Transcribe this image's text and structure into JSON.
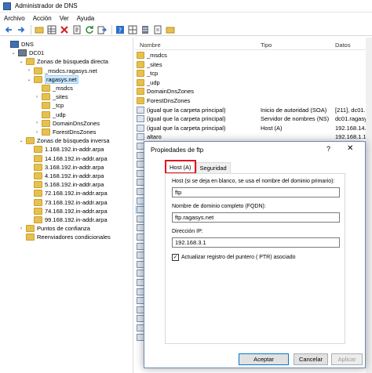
{
  "window": {
    "title": "Administrador de DNS"
  },
  "menu": [
    "Archivo",
    "Acción",
    "Ver",
    "Ayuda"
  ],
  "toolbar_icons": [
    "back-arrow-icon",
    "forward-arrow-icon",
    "folder-icon",
    "grid-icon",
    "delete-icon",
    "properties-icon",
    "refresh-icon",
    "export-icon",
    "help-icon",
    "grid-icon",
    "server-icon",
    "document-icon",
    "folder-icon"
  ],
  "tree": {
    "items": [
      {
        "label": "DNS",
        "indent": 0,
        "icon": "dns",
        "exp": ""
      },
      {
        "label": "DC01",
        "indent": 1,
        "icon": "server",
        "exp": "⌄"
      },
      {
        "label": "Zonas de búsqueda directa",
        "indent": 2,
        "icon": "folder",
        "exp": "⌄"
      },
      {
        "label": "_msdcs.ragasys.net",
        "indent": 3,
        "icon": "folder",
        "exp": "›"
      },
      {
        "label": "ragasys.net",
        "indent": 3,
        "icon": "folder",
        "exp": "⌄",
        "selected": true
      },
      {
        "label": "_msdcs",
        "indent": 4,
        "icon": "folder",
        "exp": ""
      },
      {
        "label": "_sites",
        "indent": 4,
        "icon": "folder",
        "exp": "›"
      },
      {
        "label": "_tcp",
        "indent": 4,
        "icon": "folder",
        "exp": ""
      },
      {
        "label": "_udp",
        "indent": 4,
        "icon": "folder",
        "exp": ""
      },
      {
        "label": "DomainDnsZones",
        "indent": 4,
        "icon": "folder",
        "exp": "›"
      },
      {
        "label": "ForestDnsZones",
        "indent": 4,
        "icon": "folder",
        "exp": "›"
      },
      {
        "label": "Zonas de búsqueda inversa",
        "indent": 2,
        "icon": "folder",
        "exp": "⌄"
      },
      {
        "label": "1.168.192.in-addr.arpa",
        "indent": 3,
        "icon": "folder",
        "exp": ""
      },
      {
        "label": "14.168.192.in-addr.arpa",
        "indent": 3,
        "icon": "folder",
        "exp": ""
      },
      {
        "label": "3.168.192.in-addr.arpa",
        "indent": 3,
        "icon": "folder",
        "exp": ""
      },
      {
        "label": "4.168.192.in-addr.arpa",
        "indent": 3,
        "icon": "folder",
        "exp": ""
      },
      {
        "label": "5.168.192.in-addr.arpa",
        "indent": 3,
        "icon": "folder",
        "exp": ""
      },
      {
        "label": "72.168.192.in-addr.arpa",
        "indent": 3,
        "icon": "folder",
        "exp": ""
      },
      {
        "label": "73.168.192.in-addr.arpa",
        "indent": 3,
        "icon": "folder",
        "exp": ""
      },
      {
        "label": "74.168.192.in-addr.arpa",
        "indent": 3,
        "icon": "folder",
        "exp": ""
      },
      {
        "label": "99.168.192.in-addr.arpa",
        "indent": 3,
        "icon": "folder",
        "exp": ""
      },
      {
        "label": "Puntos de confianza",
        "indent": 2,
        "icon": "folder",
        "exp": "›"
      },
      {
        "label": "Reenviadores condicionales",
        "indent": 2,
        "icon": "folder",
        "exp": ""
      }
    ]
  },
  "list": {
    "headers": {
      "name": "Nombre",
      "type": "Tipo",
      "data": "Datos"
    },
    "rows": [
      {
        "name": "_msdcs",
        "type": "",
        "data": "",
        "icon": "folder"
      },
      {
        "name": "_sites",
        "type": "",
        "data": "",
        "icon": "folder"
      },
      {
        "name": "_tcp",
        "type": "",
        "data": "",
        "icon": "folder"
      },
      {
        "name": "_udp",
        "type": "",
        "data": "",
        "icon": "folder"
      },
      {
        "name": "DomainDnsZones",
        "type": "",
        "data": "",
        "icon": "folder"
      },
      {
        "name": "ForestDnsZones",
        "type": "",
        "data": "",
        "icon": "folder"
      },
      {
        "name": "(igual que la carpeta principal)",
        "type": "Inicio de autoridad (SOA)",
        "data": "[211], dc01.ragasys",
        "icon": "record"
      },
      {
        "name": "(igual que la carpeta principal)",
        "type": "Servidor de nombres (NS)",
        "data": "dc01.ragasys.net.",
        "icon": "record"
      },
      {
        "name": "(igual que la carpeta principal)",
        "type": "Host (A)",
        "data": "192.168.14.1",
        "icon": "record"
      },
      {
        "name": "altaro",
        "type": "",
        "data": "192.168.1.1",
        "icon": "record"
      },
      {
        "name": "centr",
        "type": "",
        "data": "",
        "icon": "record"
      },
      {
        "name": "centr",
        "type": "",
        "data": "",
        "icon": "record"
      },
      {
        "name": "dc01",
        "type": "",
        "data": "",
        "icon": "record"
      },
      {
        "name": "dmz-",
        "type": "",
        "data": "",
        "icon": "record"
      },
      {
        "name": "esxi0",
        "type": "",
        "data": "",
        "icon": "record"
      },
      {
        "name": "esxi0",
        "type": "",
        "data": "",
        "icon": "record"
      },
      {
        "name": "fg50",
        "type": "",
        "data": "210",
        "icon": "record"
      },
      {
        "name": "ftp",
        "type": "",
        "data": "",
        "icon": "record",
        "selected": true
      },
      {
        "name": "ftthm",
        "type": "",
        "data": "",
        "icon": "record"
      },
      {
        "name": "gestio",
        "type": "",
        "data": "",
        "icon": "record"
      },
      {
        "name": "gestio",
        "type": "",
        "data": "",
        "icon": "record"
      },
      {
        "name": "iscsia",
        "type": "",
        "data": "",
        "icon": "record"
      },
      {
        "name": "iscsib",
        "type": "",
        "data": "",
        "icon": "record"
      },
      {
        "name": "iscsia",
        "type": "",
        "data": "",
        "icon": "record"
      },
      {
        "name": "lanrg",
        "type": "",
        "data": "",
        "icon": "record"
      },
      {
        "name": "nfsph",
        "type": "",
        "data": "",
        "icon": "record"
      },
      {
        "name": "piholo",
        "type": "",
        "data": "",
        "icon": "record"
      },
      {
        "name": "sward",
        "type": "",
        "data": "",
        "icon": "record"
      },
      {
        "name": "sward",
        "type": "",
        "data": "",
        "icon": "record"
      },
      {
        "name": "vcsa",
        "type": "",
        "data": "",
        "icon": "record"
      },
      {
        "name": "veeam",
        "type": "",
        "data": "",
        "icon": "record"
      },
      {
        "name": "veeam",
        "type": "",
        "data": "",
        "icon": "record"
      }
    ]
  },
  "dialog": {
    "title": "Propiedades de ftp",
    "help": "?",
    "close": "✕",
    "tabs": [
      {
        "label": "Host (A)",
        "active": true
      },
      {
        "label": "Seguridad",
        "active": false
      }
    ],
    "host_label": "Host (si se deja en blanco, se usa el nombre del dominio primario):",
    "host_value": "ftp",
    "fqdn_label": "Nombre de dominio completo (FQDN):",
    "fqdn_value": "ftp.ragasys.net",
    "ip_label": "Dirección IP:",
    "ip_value": "192.168.3.1",
    "checkbox_label": "Actualizar registro del puntero ( PTR) asociado",
    "checkbox_checked": true,
    "buttons": {
      "ok": "Aceptar",
      "cancel": "Cancelar",
      "apply": "Aplicar"
    }
  },
  "colors": {
    "accent": "#0078d7",
    "tab_highlight": "#e0161c",
    "folder": "#e8c04f",
    "selection": "#cce8ff"
  }
}
